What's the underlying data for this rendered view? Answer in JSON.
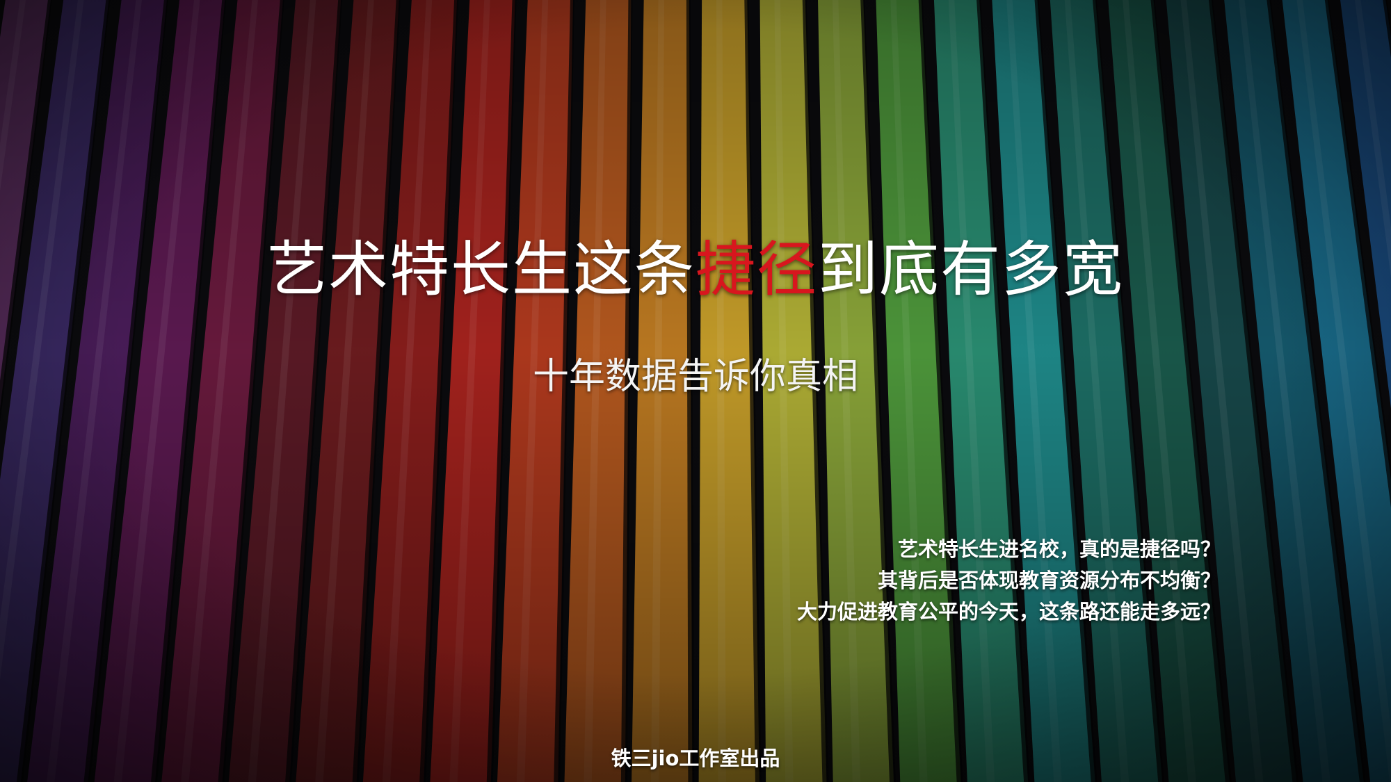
{
  "title": {
    "before": "艺术特长生这条",
    "highlight": "捷径",
    "after": "到底有多宽"
  },
  "subtitle": "十年数据告诉你真相",
  "questions": [
    "艺术特长生进名校，真的是捷径吗？",
    "其背后是否体现教育资源分布不均衡？",
    "大力促进教育公平的今天，这条路还能走多远？"
  ],
  "credit": "铁三jio工作室出品",
  "colors": {
    "highlight": "#d8161e",
    "text": "#ffffff",
    "pencils": [
      "#8f8b92",
      "#6e5563",
      "#5a2d5e",
      "#3b2a66",
      "#4a1d5a",
      "#5d1a52",
      "#6a1a3e",
      "#5c1a26",
      "#6d1c1f",
      "#8a1e1c",
      "#a8231e",
      "#b33a1e",
      "#b85a1f",
      "#c07c22",
      "#c9a02a",
      "#b3b236",
      "#8da83a",
      "#4f9a3c",
      "#2a8f73",
      "#1f8b8b",
      "#1d6f66",
      "#1a5a4c",
      "#17484a",
      "#155a6e",
      "#1a6f8f",
      "#1b4f86",
      "#1a3b6e"
    ]
  }
}
